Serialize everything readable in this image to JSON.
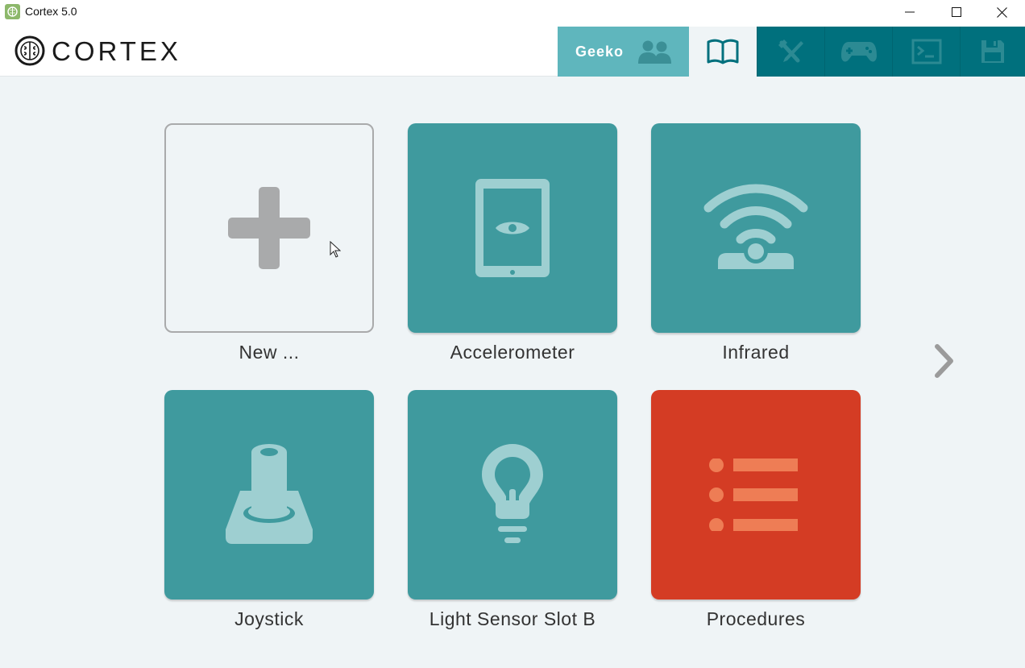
{
  "window": {
    "title": "Cortex 5.0",
    "icon": "brain-icon"
  },
  "header": {
    "logo_text": "CORTEX",
    "user_label": "Geeko",
    "nav": [
      {
        "name": "user-profiles",
        "icon": "users-icon",
        "active": false
      },
      {
        "name": "book",
        "icon": "book-icon",
        "active": true
      },
      {
        "name": "tools",
        "icon": "tools-icon",
        "active": false
      },
      {
        "name": "gamepad",
        "icon": "gamepad-icon",
        "active": false
      },
      {
        "name": "terminal",
        "icon": "terminal-icon",
        "active": false
      },
      {
        "name": "save",
        "icon": "floppy-icon",
        "active": false
      }
    ]
  },
  "tiles": [
    {
      "label": "New ...",
      "icon": "plus-icon",
      "style": "new"
    },
    {
      "label": "Accelerometer",
      "icon": "tablet-eye-icon",
      "style": "teal"
    },
    {
      "label": "Infrared",
      "icon": "infrared-icon",
      "style": "teal"
    },
    {
      "label": "Joystick",
      "icon": "joystick-icon",
      "style": "teal"
    },
    {
      "label": "Light Sensor Slot B",
      "icon": "lightbulb-icon",
      "style": "teal"
    },
    {
      "label": "Procedures",
      "icon": "list-icon",
      "style": "red"
    }
  ],
  "colors": {
    "teal": "#3f9a9e",
    "teal_light": "#5fb6bd",
    "teal_dark": "#00707d",
    "red": "#d43c24",
    "icon_light": "#9ecfd1",
    "icon_orange": "#ee7d55",
    "gray": "#a9aaab",
    "background": "#eff4f6"
  }
}
